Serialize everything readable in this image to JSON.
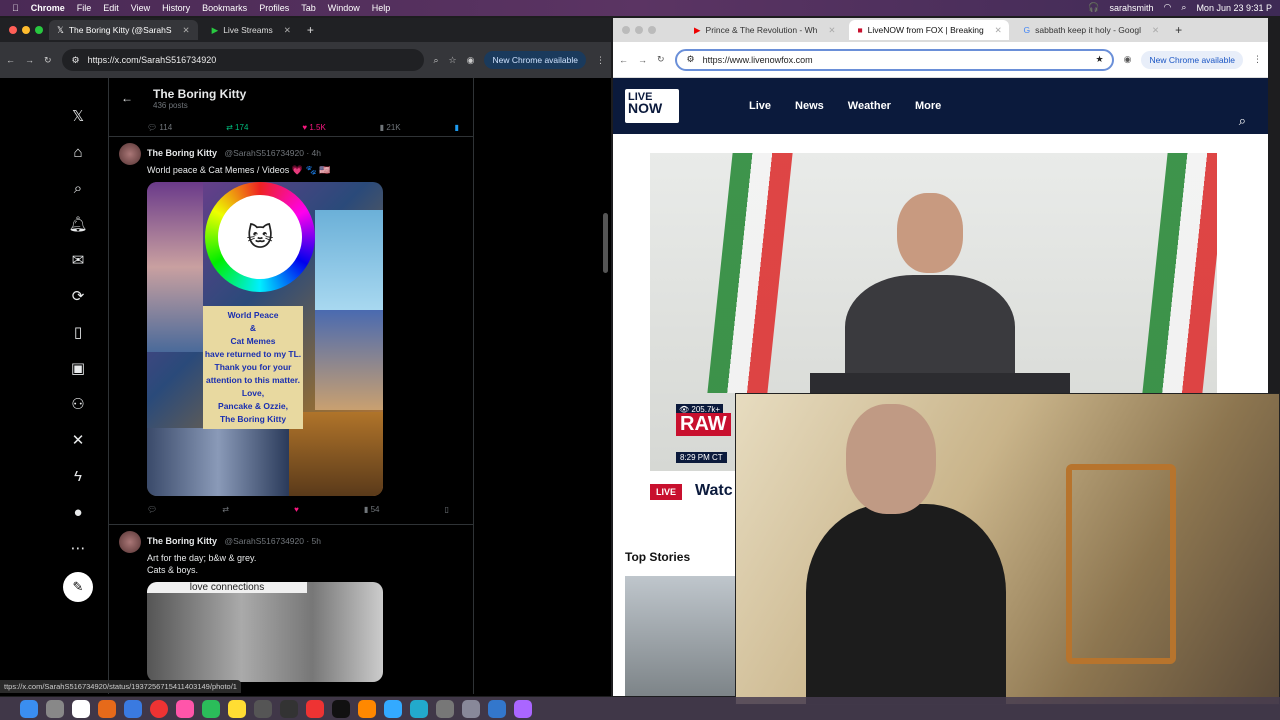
{
  "menubar": {
    "app": "Chrome",
    "items": [
      "File",
      "Edit",
      "View",
      "History",
      "Bookmarks",
      "Profiles",
      "Tab",
      "Window",
      "Help"
    ],
    "user": "sarahsmith",
    "clock": "Mon Jun 23  9:31 P"
  },
  "left_browser": {
    "tabs": [
      {
        "label": "The Boring Kitty (@SarahS",
        "active": true
      },
      {
        "label": "Live Streams",
        "active": false
      }
    ],
    "url": "https://x.com/SarahS516734920",
    "chrome_notice": "New Chrome available",
    "status_url": "ttps://x.com/SarahS516734920/status/1937256715411403149/photo/1"
  },
  "x_feed": {
    "profile_title": "The Boring Kitty",
    "profile_sub": "436 posts",
    "top_stats": {
      "replies": "114",
      "reposts": "174",
      "likes": "1.5K",
      "views": "21K"
    },
    "tweets": [
      {
        "name": "The Boring Kitty",
        "handle": "@SarahS516734920 · 4h",
        "text": "World peace & Cat Memes / Videos 💗 🐾 🇺🇸",
        "image_text": [
          "World Peace",
          "&",
          "Cat Memes",
          "have returned to my TL.",
          "Thank you for your",
          "attention to this matter.",
          "Love,",
          "Pancake & Ozzie,",
          "The Boring Kitty"
        ],
        "stats": {
          "replies": "",
          "reposts": "",
          "likes": "",
          "views": "54"
        }
      },
      {
        "name": "The Boring Kitty",
        "handle": "@SarahS516734920 · 5h",
        "text_lines": [
          "Art for the day; b&w & grey.",
          "Cats & boys."
        ],
        "image_caption": "love connections"
      }
    ]
  },
  "right_browser": {
    "tabs": [
      {
        "label": "Prince & The Revolution - Wh",
        "active": false
      },
      {
        "label": "LiveNOW from FOX | Breaking",
        "active": true
      },
      {
        "label": "sabbath keep it holy - Googl",
        "active": false
      }
    ],
    "url": "https://www.livenowfox.com",
    "chrome_notice": "New Chrome available"
  },
  "livenow": {
    "logo_top": "LIVE",
    "logo_bottom": "NOW",
    "nav": [
      "Live",
      "News",
      "Weather",
      "More"
    ],
    "viewers": "205.7k+",
    "raw_label": "RAW",
    "raw_time": "8:29 PM CT",
    "live_badge": "LIVE",
    "watch_text": "Watc",
    "top_stories": "Top Stories"
  },
  "colors": {
    "x_like": "#f91880",
    "x_repost": "#00ba7c",
    "livenow_navy": "#0b1a3c",
    "livenow_red": "#c8102e"
  }
}
